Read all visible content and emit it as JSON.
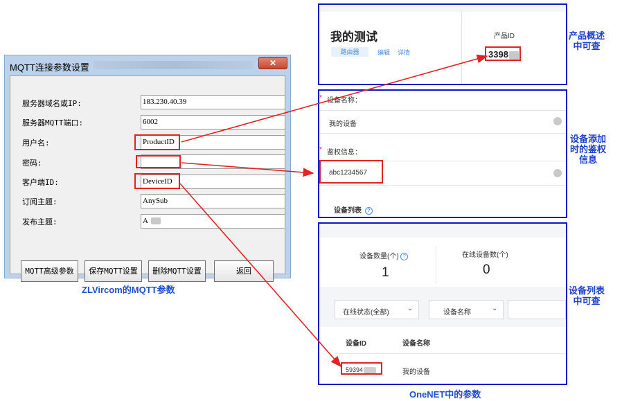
{
  "dialog": {
    "title": "MQTT连接参数设置",
    "close_label": "✕",
    "fields": [
      {
        "label": "服务器域名或IP:",
        "value": "183.230.40.39"
      },
      {
        "label": "服务器MQTT端口:",
        "value": "6002"
      },
      {
        "label": "用户名:",
        "value": "ProductID"
      },
      {
        "label": "密码:",
        "value": ""
      },
      {
        "label": "客户端ID:",
        "value": "DeviceID"
      },
      {
        "label": "订阅主题:",
        "value": "AnySub"
      },
      {
        "label": "发布主题:",
        "value": "A"
      }
    ],
    "buttons": [
      "MQTT高级参数",
      "保存MQTT设置",
      "删除MQTT设置",
      "返回"
    ]
  },
  "caption_left": "ZLVircom的MQTT参数",
  "overview": {
    "product_title": "我的测试",
    "tag": "路由器",
    "link_edit": "编辑",
    "link_detail": "详情",
    "product_id_label": "产品ID",
    "product_id_value": "3398",
    "note": "产品概述中可查"
  },
  "add_device": {
    "name_label": "设备名称：",
    "name_value": "我的设备",
    "auth_label": "鉴权信息：",
    "auth_value": "abc1234567",
    "list_title": "设备列表",
    "help_icon": "?",
    "note": "设备添加时的鉴权信息"
  },
  "device_list": {
    "count_label": "设备数量(个)",
    "count_value": "1",
    "online_label": "在线设备数(个)",
    "online_value": "0",
    "filter_status": "在线状态(全部)",
    "filter_name": "设备名称",
    "col_id": "设备ID",
    "col_name": "设备名称",
    "row_id": "59394",
    "row_name": "我的设备",
    "note": "设备列表中可查"
  },
  "caption_right": "OneNET中的参数",
  "colors": {
    "highlight": "#e52222",
    "panel_border": "#1414c8",
    "caption": "#1f4fcc"
  }
}
